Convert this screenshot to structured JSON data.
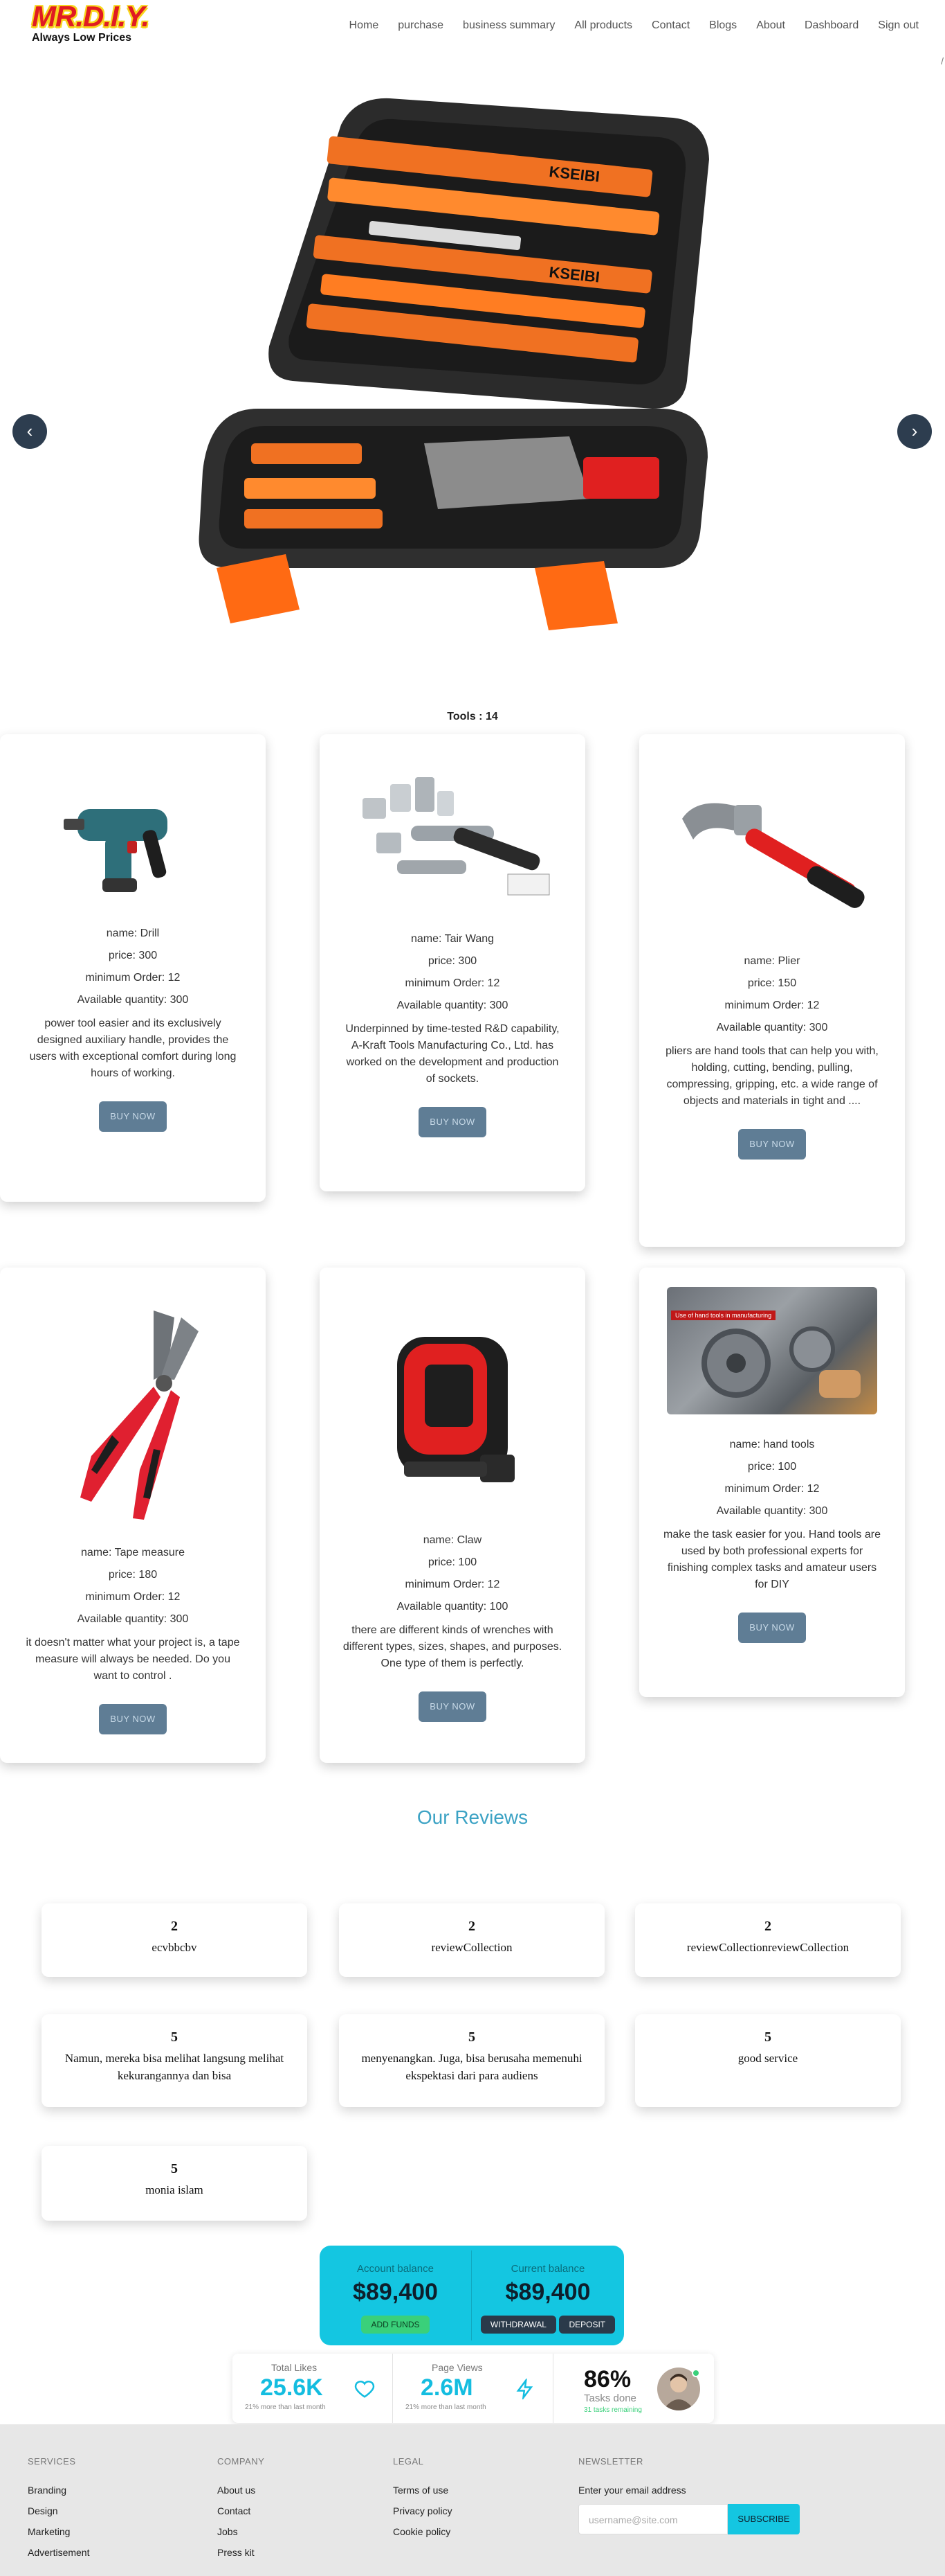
{
  "header": {
    "logo_brand": "MR.D.I.Y.",
    "logo_slogan": "Always Low Prices",
    "nav": [
      "Home",
      "purchase",
      "business summary",
      "All products",
      "Contact",
      "Blogs",
      "About",
      "Dashboard",
      "Sign out"
    ],
    "slash": "/"
  },
  "carousel": {
    "prev_label": "‹",
    "next_label": "›",
    "slide_image": "toolbox-kseibi-orange-case"
  },
  "tools_count": "Tools : 14",
  "products": [
    {
      "image": "drill",
      "name": "name: Drill",
      "price": "price: 300",
      "min_order": "minimum Order: 12",
      "qty": "Available quantity: 300",
      "desc": "power tool easier and its exclusively designed auxiliary handle, provides the users with exceptional comfort during long hours of working.",
      "button": "BUY NOW"
    },
    {
      "image": "socket-wrench-set",
      "name": "name: Tair Wang",
      "price": "price: 300",
      "min_order": "minimum Order: 12",
      "qty": "Available quantity: 300",
      "desc": "Underpinned by time-tested R&D capability, A-Kraft Tools Manufacturing Co., Ltd. has worked on the development and production of sockets.",
      "button": "BUY NOW"
    },
    {
      "image": "claw-hammer",
      "name": "name: Plier",
      "price": "price: 150",
      "min_order": "minimum Order: 12",
      "qty": "Available quantity: 300",
      "desc": "pliers are hand tools that can help you with, holding, cutting, bending, pulling, compressing, gripping, etc. a wide range of objects and materials in tight and ....",
      "button": "BUY NOW"
    },
    {
      "image": "pliers",
      "name": "name: Tape measure",
      "price": "price: 180",
      "min_order": "minimum Order: 12",
      "qty": "Available quantity: 300",
      "desc": "it doesn't matter what your project is, a tape measure will always be needed. Do you want to control .",
      "button": "BUY NOW"
    },
    {
      "image": "tape-measure",
      "name": "name: Claw",
      "price": "price: 100",
      "min_order": "minimum Order: 12",
      "qty": "Available quantity: 100",
      "desc": "there are different kinds of wrenches with different types, sizes, shapes, and purposes. One type of them is perfectly.",
      "button": "BUY NOW"
    },
    {
      "image": "hand-tools-photo",
      "image_caption": "Use of hand tools in manufacturing",
      "name": "name: hand tools",
      "price": "price: 100",
      "min_order": "minimum Order: 12",
      "qty": "Available quantity: 300",
      "desc": "make the task easier for you. Hand tools are used by both professional experts for finishing complex tasks and amateur users for DIY",
      "button": "BUY NOW"
    }
  ],
  "reviews": {
    "title": "Our Reviews",
    "items": [
      {
        "rating": "2",
        "text": "ecvbbcbv"
      },
      {
        "rating": "2",
        "text": "reviewCollection"
      },
      {
        "rating": "2",
        "text": "reviewCollectionreviewCollection"
      },
      {
        "rating": "5",
        "text": "Namun, mereka bisa melihat langsung melihat kekurangannya dan bisa"
      },
      {
        "rating": "5",
        "text": "menyenangkan. Juga, bisa berusaha memenuhi ekspektasi dari para audiens"
      },
      {
        "rating": "5",
        "text": "good service"
      },
      {
        "rating": "5",
        "text": "monia islam"
      }
    ]
  },
  "balance": {
    "account_label": "Account balance",
    "account_value": "$89,400",
    "add_funds": "ADD FUNDS",
    "current_label": "Current balance",
    "current_value": "$89,400",
    "withdrawal": "WITHDRAWAL",
    "deposit": "DEPOSIT"
  },
  "stats": {
    "likes_label": "Total Likes",
    "likes_value": "25.6K",
    "likes_sub": "21% more than last month",
    "views_label": "Page Views",
    "views_value": "2.6M",
    "views_sub": "21% more than last month",
    "tasks_value": "86%",
    "tasks_label": "Tasks done",
    "tasks_sub": "31 tasks remaining"
  },
  "footer": {
    "services_title": "SERVICES",
    "services": [
      "Branding",
      "Design",
      "Marketing",
      "Advertisement"
    ],
    "company_title": "COMPANY",
    "company": [
      "About us",
      "Contact",
      "Jobs",
      "Press kit"
    ],
    "legal_title": "LEGAL",
    "legal": [
      "Terms of use",
      "Privacy policy",
      "Cookie policy"
    ],
    "newsletter_title": "NEWSLETTER",
    "newsletter_label": "Enter your email address",
    "newsletter_placeholder": "username@site.com",
    "subscribe": "SUBSCRIBE"
  },
  "colors": {
    "accent": "#14c6e1",
    "buy_button": "#5f7d95",
    "reviews_title": "#3ba2c4",
    "footer_bg": "#e7e7e7",
    "logo_red": "#e01b22",
    "logo_yellow": "#f7d51d"
  }
}
